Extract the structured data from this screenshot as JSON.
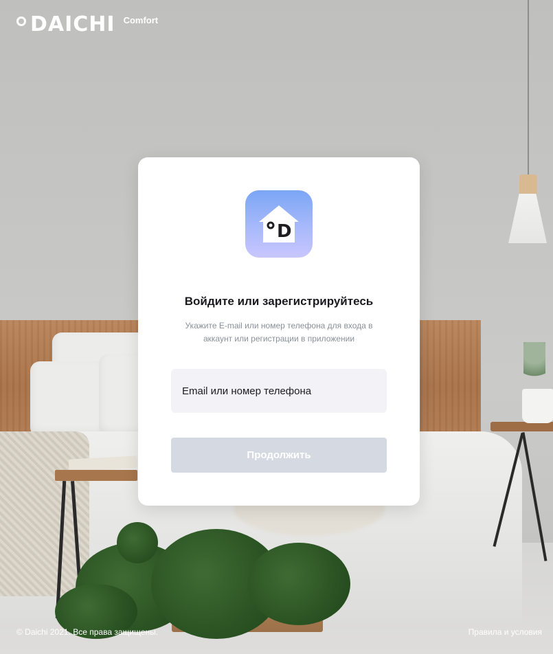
{
  "brand": {
    "name": "DAICHI",
    "sub": "Comfort",
    "color": "#ffffff"
  },
  "login": {
    "icon": "daichi-home-app-icon",
    "title": "Войдите или зарегистрируйтесь",
    "subtitle": "Укажите E-mail или номер телефона для входа в аккаунт или регистрации в приложении",
    "field_placeholder": "Email или номер телефона",
    "field_value": "",
    "submit_label": "Продолжить",
    "submit_enabled": false,
    "icon_gradient": [
      "#7ba6f5",
      "#c9c6ff"
    ],
    "submit_color": "#d5dae2"
  },
  "footer": {
    "copyright": "© Daichi 2021. Все права защищены.",
    "terms_link": "Правила и условия"
  }
}
